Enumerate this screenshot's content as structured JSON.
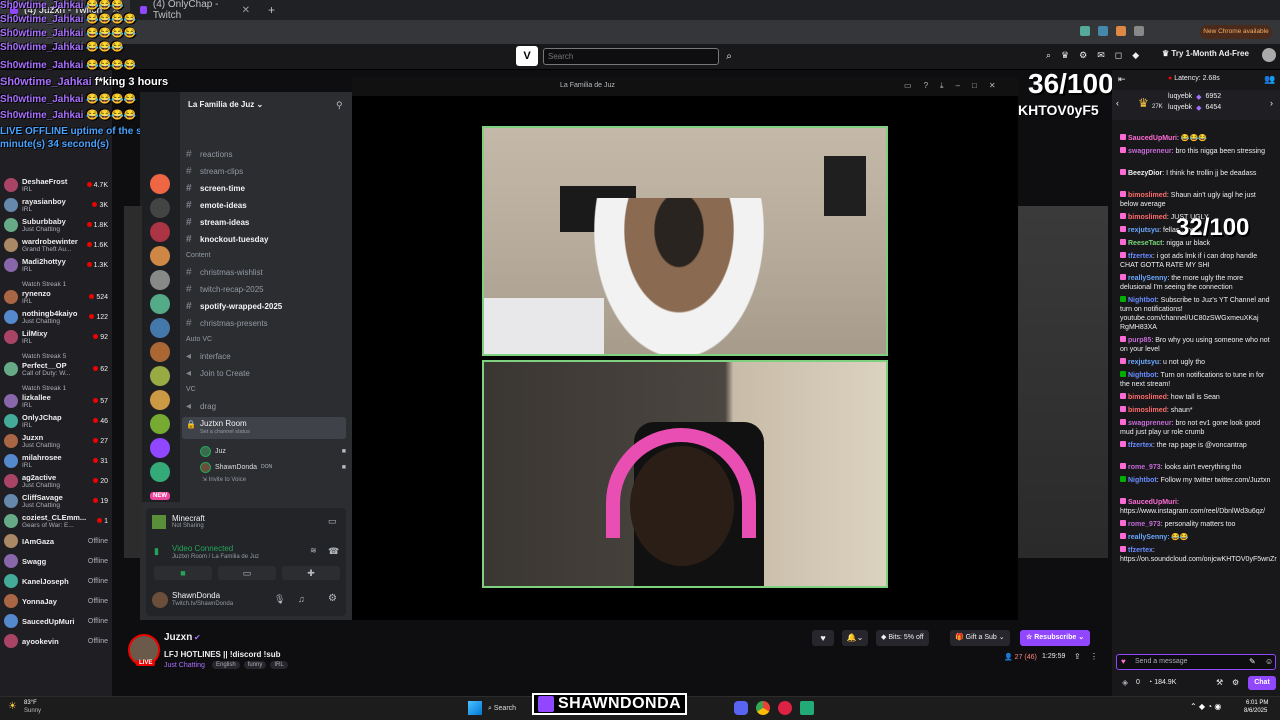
{
  "browser": {
    "tabs": [
      {
        "label": "(4) Juzxn - Twitch"
      },
      {
        "label": "(4) OnlyChap - Twitch"
      }
    ],
    "new_chrome": "New Chrome available"
  },
  "twitch": {
    "search_placeholder": "Search",
    "ad_free": "Try 1-Month Ad-Free",
    "streamer": "Juzxn",
    "stream_title": "LFJ HOTLINES || !discord !sub",
    "category": "Just Chatting",
    "tags": [
      "English",
      "funny",
      "IRL"
    ],
    "live_label": "LIVE",
    "viewers": "27 (46)",
    "uptime": "1:29:59",
    "bits": "Bits: 5% off",
    "gift": "Gift a Sub",
    "resub": "Resubscribe",
    "latency": "Latency: 2.68s",
    "chat_input_placeholder": "Send a message",
    "chat_button": "Chat",
    "points": "184.9K",
    "points_zero": "0",
    "leaderboard": [
      {
        "name": "luqyebk",
        "value": "6952"
      },
      {
        "name": "luqyebk",
        "value": "6454",
        "badge": "27K"
      }
    ]
  },
  "overlay": {
    "score_big": "36/100",
    "score_code": "KHTOV0yF5",
    "score_small": "32/100",
    "streamer_badge": "SHAWNDONDA",
    "spam_user": "Sh0wtime_Jahkai",
    "spam_top": "f*king 3 hours",
    "offline_msg": "LIVE OFFLINE uptime of the session was 1 minute(s) 34 second(s)"
  },
  "left_rail": [
    {
      "name": "DeshaeFrost",
      "game": "IRL",
      "count": "4.7K"
    },
    {
      "name": "rayasianboy",
      "game": "IRL",
      "count": "3K"
    },
    {
      "name": "Suburbbaby",
      "game": "Just Chatting",
      "count": "1.8K"
    },
    {
      "name": "wardrobewinter",
      "game": "Grand Theft Au...",
      "count": "1.6K"
    },
    {
      "name": "Madi2hottyy",
      "game": "IRL",
      "count": "1.3K"
    },
    {
      "name": "",
      "game": "Watch Streak 1",
      "count": ""
    },
    {
      "name": "rynenzo",
      "game": "IRL",
      "count": "524"
    },
    {
      "name": "nothingb4kaiyo",
      "game": "Just Chatting",
      "count": "122"
    },
    {
      "name": "LilMixy",
      "game": "IRL",
      "count": "92"
    },
    {
      "name": "",
      "game": "Watch Streak 5",
      "count": ""
    },
    {
      "name": "Perfect__OP",
      "game": "Call of Duty: W...",
      "count": "62"
    },
    {
      "name": "",
      "game": "Watch Streak 1",
      "count": ""
    },
    {
      "name": "lizkallee",
      "game": "IRL",
      "count": "57"
    },
    {
      "name": "OnlyJChap",
      "game": "IRL",
      "count": "46"
    },
    {
      "name": "Juzxn",
      "game": "Just Chatting",
      "count": "27"
    },
    {
      "name": "milahrosee",
      "game": "IRL",
      "count": "31"
    },
    {
      "name": "ag2active",
      "game": "Just Chatting",
      "count": "20"
    },
    {
      "name": "CliffSavage",
      "game": "Just Chatting",
      "count": "19"
    },
    {
      "name": "coziest_CLEmm...",
      "game": "Gears of War: E...",
      "count": "1"
    },
    {
      "name": "IAmGaza",
      "game": "",
      "count": "Offline"
    },
    {
      "name": "Swagg",
      "game": "",
      "count": "Offline"
    },
    {
      "name": "KanelJoseph",
      "game": "",
      "count": "Offline"
    },
    {
      "name": "YonnaJay",
      "game": "",
      "count": "Offline"
    },
    {
      "name": "SaucedUpMuri",
      "game": "",
      "count": "Offline"
    },
    {
      "name": "ayookevin",
      "game": "",
      "count": "Offline"
    }
  ],
  "discord": {
    "window_title": "La Familia de Juz",
    "server_name": "La Familia de Juz",
    "channels": [
      {
        "name": "reactions",
        "bold": false
      },
      {
        "name": "stream-clips",
        "bold": false
      },
      {
        "name": "screen-time",
        "bold": true
      },
      {
        "name": "emote-ideas",
        "bold": true
      },
      {
        "name": "stream-ideas",
        "bold": true
      },
      {
        "name": "knockout-tuesday",
        "bold": true
      }
    ],
    "cat_content": "Content",
    "content_channels": [
      {
        "name": "christmas-wishlist",
        "bold": false
      },
      {
        "name": "twitch-recap-2025",
        "bold": false
      },
      {
        "name": "spotify-wrapped-2025",
        "bold": true
      },
      {
        "name": "christmas-presents",
        "bold": false
      }
    ],
    "cat_auto_vc": "Auto VC",
    "auto_vc": [
      "interface",
      "Join to Create"
    ],
    "cat_vc": "VC",
    "vc": [
      "drag"
    ],
    "voice_room": "Juztxn Room",
    "voice_status": "Set a channel status",
    "members": [
      "Juz",
      "ShawnDonda"
    ],
    "member_tag": "DON",
    "invite": "Invite to Voice",
    "activity": "Minecraft",
    "activity_sub": "Not Sharing",
    "video_connected": "Video Connected",
    "video_sub": "Juztxn Room / La Familia de Juz",
    "user_name": "ShawnDonda",
    "user_sub": "Twitch.tv/ShawnDonda",
    "new_badge": "NEW"
  },
  "chat": [
    {
      "user": "SaucedUpMuri",
      "color": "#ff6bd6",
      "text": ": 😂😂😂"
    },
    {
      "user": "swagpreneur",
      "color": "#c46ad6",
      "text": ": bro this nigga been stressing"
    },
    {
      "user": "BeezyDior",
      "color": "#efeff1",
      "text": ": I think he trollin jj be deadass"
    },
    {
      "user": "bimoslimed",
      "color": "#ff6b6b",
      "text": ": Shaun ain't ugly iagl he just below average"
    },
    {
      "user": "bimoslimed",
      "color": "#ff6b6b",
      "text": ": JUST UGLY"
    },
    {
      "user": "rexjutsyu",
      "color": "#6aa9ff",
      "text": ": fellas... be a"
    },
    {
      "user": "ReeseTact",
      "color": "#7ad67a",
      "text": ": nigga ur black"
    },
    {
      "user": "tfzertex",
      "color": "#6a8cff",
      "text": ": i got ads lmk if i can drop handle CHAT GOTTA RATE MY SHI"
    },
    {
      "user": "reallySenny",
      "color": "#6aa9ff",
      "text": ": the more ugly the more delusional I'm seeing the connection"
    },
    {
      "user": "Nightbot",
      "color": "#6a8cff",
      "text": ": Subscribe to Juz's YT Channel and turn on notifications! youtube.com/channel/UC80zSWGxmeuXKaj RgMH83XA"
    },
    {
      "user": "purp85",
      "color": "#c46ad6",
      "text": ": Bro why you using someone who not on your level"
    },
    {
      "user": "rexjutsyu",
      "color": "#6aa9ff",
      "text": ": u not ugly tho"
    },
    {
      "user": "Nightbot",
      "color": "#6a8cff",
      "text": ": Turn on notifications to tune in for the next stream!"
    },
    {
      "user": "bimoslimed",
      "color": "#ff6b6b",
      "text": ": how tall is Sean"
    },
    {
      "user": "bimoslimed",
      "color": "#ff6b6b",
      "text": ": shaun*"
    },
    {
      "user": "swagpreneur",
      "color": "#c46ad6",
      "text": ": bro not ev1 gone look good mud just play ur role crumb"
    },
    {
      "user": "tfzertex",
      "color": "#6a8cff",
      "text": ": the rap page is @voncantrap"
    },
    {
      "user": "rome_973",
      "color": "#c46ad6",
      "text": ": looks ain't everything tho"
    },
    {
      "user": "Nightbot",
      "color": "#6a8cff",
      "text": ": Follow my twitter twitter.com/Juztxn"
    },
    {
      "user": "SaucedUpMuri",
      "color": "#ff6bd6",
      "text": ": https://www.instagram.com/reel/DbnlWd3u6qz/"
    },
    {
      "user": "rome_973",
      "color": "#c46ad6",
      "text": ": personality matters too"
    },
    {
      "user": "reallySenny",
      "color": "#6aa9ff",
      "text": ": 😂😂"
    },
    {
      "user": "tfzertex",
      "color": "#6a8cff",
      "text": ": https://on.soundcloud.com/onjcwKHTOV0yF5wnZr"
    }
  ],
  "taskbar": {
    "weather_temp": "83°F",
    "weather": "Sunny",
    "search": "Search",
    "time": "6:01 PM",
    "date": "8/6/2025"
  }
}
